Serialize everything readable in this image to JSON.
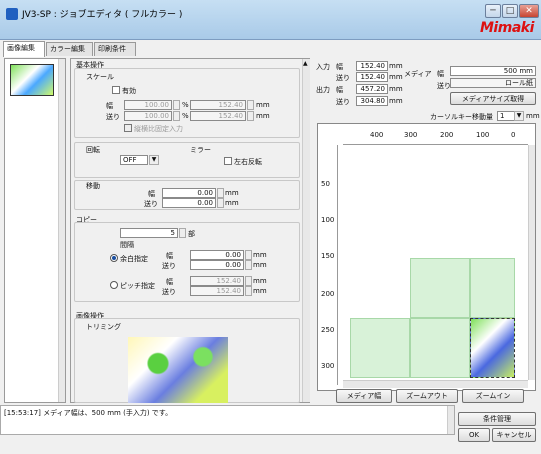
{
  "window": {
    "title": "JV3-SP : ジョブエディタ ( フルカラー )",
    "brand": "Mimaki",
    "controls": {
      "min": "─",
      "max": "□",
      "close": "✕"
    }
  },
  "tabs": [
    {
      "label": "画像編集"
    },
    {
      "label": "カラー編集"
    },
    {
      "label": "印刷条件"
    }
  ],
  "basic": {
    "title": "基本操作",
    "scale": {
      "title": "スケール",
      "enable_label": "有効",
      "width_label": "幅",
      "feed_label": "送り",
      "width_pct": "100.00",
      "feed_pct": "100.00",
      "pct_unit": "%",
      "width_mm": "152.40",
      "feed_mm": "152.40",
      "mm_unit": "mm",
      "lock_ratio": "縦横比固定入力"
    }
  },
  "rotate": {
    "title": "回転",
    "value": "OFF"
  },
  "mirror": {
    "title": "ミラー",
    "lr_flip": "左右反転"
  },
  "move": {
    "title": "移動",
    "width_label": "幅",
    "feed_label": "送り",
    "width": "0.00",
    "feed": "0.00",
    "unit": "mm"
  },
  "copy": {
    "title": "コピー",
    "count": "5",
    "count_unit": "部",
    "spacing_title": "間隔",
    "margin_mode": "余白指定",
    "pitch_mode": "ピッチ指定",
    "width_label": "幅",
    "feed_label": "送り",
    "margin_w": "0.00",
    "margin_f": "0.00",
    "pitch_w": "152.40",
    "pitch_f": "152.40",
    "unit": "mm"
  },
  "image_ops": {
    "title": "画像操作",
    "trimming": "トリミング"
  },
  "right": {
    "input_label": "入力",
    "output_label": "出力",
    "width_label": "幅",
    "feed_label": "送り",
    "in_w": "152.40",
    "in_f": "152.40",
    "out_w": "457.20",
    "out_f": "304.80",
    "unit": "mm",
    "media_label": "メディア",
    "media_w": "500 mm",
    "media_feed": "ロール紙",
    "get_media_btn": "メディアサイズ取得",
    "cursor_label": "カーソルキー移動量",
    "cursor_val": "1",
    "cursor_unit": "mm"
  },
  "ruler": {
    "h": [
      "400",
      "300",
      "200",
      "100",
      "0"
    ],
    "v": [
      "50",
      "100",
      "150",
      "200",
      "250",
      "300"
    ]
  },
  "canvas_buttons": {
    "media_width": "メディア幅",
    "zoom_out": "ズームアウト",
    "zoom_in": "ズームイン"
  },
  "status": {
    "message": "[15:53:17] メディア幅は、500 mm (手入力) です。"
  },
  "footer": {
    "condition_mgmt": "条件管理",
    "ok": "OK",
    "cancel": "キャンセル"
  }
}
